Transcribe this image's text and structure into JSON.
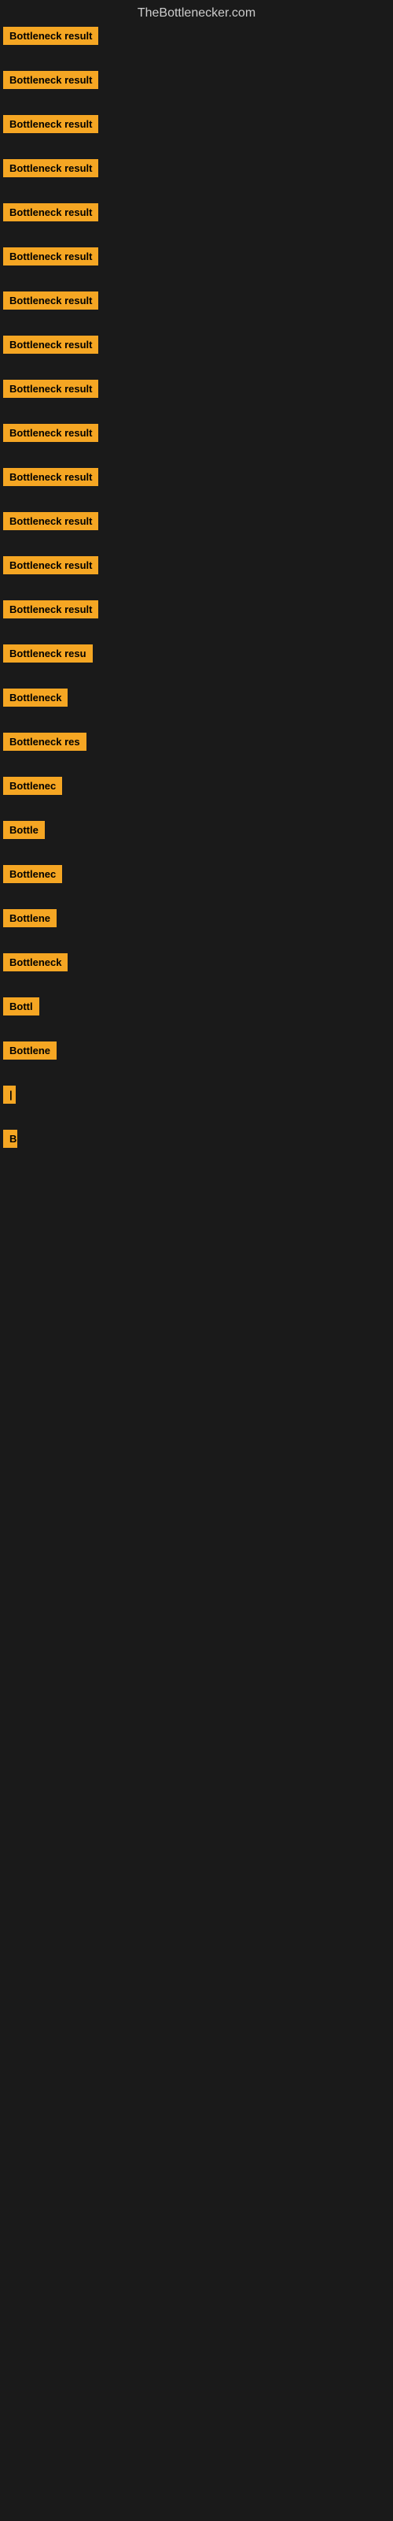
{
  "site": {
    "title": "TheBottlenecker.com"
  },
  "items": [
    {
      "id": 1,
      "label": "Bottleneck result",
      "visible_width": 160
    },
    {
      "id": 2,
      "label": "Bottleneck result",
      "visible_width": 160
    },
    {
      "id": 3,
      "label": "Bottleneck result",
      "visible_width": 160
    },
    {
      "id": 4,
      "label": "Bottleneck result",
      "visible_width": 160
    },
    {
      "id": 5,
      "label": "Bottleneck result",
      "visible_width": 160
    },
    {
      "id": 6,
      "label": "Bottleneck result",
      "visible_width": 160
    },
    {
      "id": 7,
      "label": "Bottleneck result",
      "visible_width": 160
    },
    {
      "id": 8,
      "label": "Bottleneck result",
      "visible_width": 160
    },
    {
      "id": 9,
      "label": "Bottleneck result",
      "visible_width": 160
    },
    {
      "id": 10,
      "label": "Bottleneck result",
      "visible_width": 160
    },
    {
      "id": 11,
      "label": "Bottleneck result",
      "visible_width": 160
    },
    {
      "id": 12,
      "label": "Bottleneck result",
      "visible_width": 160
    },
    {
      "id": 13,
      "label": "Bottleneck result",
      "visible_width": 160
    },
    {
      "id": 14,
      "label": "Bottleneck result",
      "visible_width": 160
    },
    {
      "id": 15,
      "label": "Bottleneck resu",
      "visible_width": 130
    },
    {
      "id": 16,
      "label": "Bottleneck",
      "visible_width": 90
    },
    {
      "id": 17,
      "label": "Bottleneck res",
      "visible_width": 115
    },
    {
      "id": 18,
      "label": "Bottlenec",
      "visible_width": 80
    },
    {
      "id": 19,
      "label": "Bottle",
      "visible_width": 58
    },
    {
      "id": 20,
      "label": "Bottlenec",
      "visible_width": 80
    },
    {
      "id": 21,
      "label": "Bottlene",
      "visible_width": 72
    },
    {
      "id": 22,
      "label": "Bottleneck",
      "visible_width": 90
    },
    {
      "id": 23,
      "label": "Bottl",
      "visible_width": 50
    },
    {
      "id": 24,
      "label": "Bottlene",
      "visible_width": 72
    },
    {
      "id": 25,
      "label": "|",
      "visible_width": 14
    },
    {
      "id": 26,
      "label": "",
      "visible_width": 0
    },
    {
      "id": 27,
      "label": "",
      "visible_width": 0
    },
    {
      "id": 28,
      "label": "",
      "visible_width": 0
    },
    {
      "id": 29,
      "label": "B",
      "visible_width": 18
    },
    {
      "id": 30,
      "label": "",
      "visible_width": 0
    },
    {
      "id": 31,
      "label": "",
      "visible_width": 0
    },
    {
      "id": 32,
      "label": "",
      "visible_width": 0
    },
    {
      "id": 33,
      "label": "",
      "visible_width": 0
    },
    {
      "id": 34,
      "label": "",
      "visible_width": 0
    },
    {
      "id": 35,
      "label": "",
      "visible_width": 0
    }
  ]
}
